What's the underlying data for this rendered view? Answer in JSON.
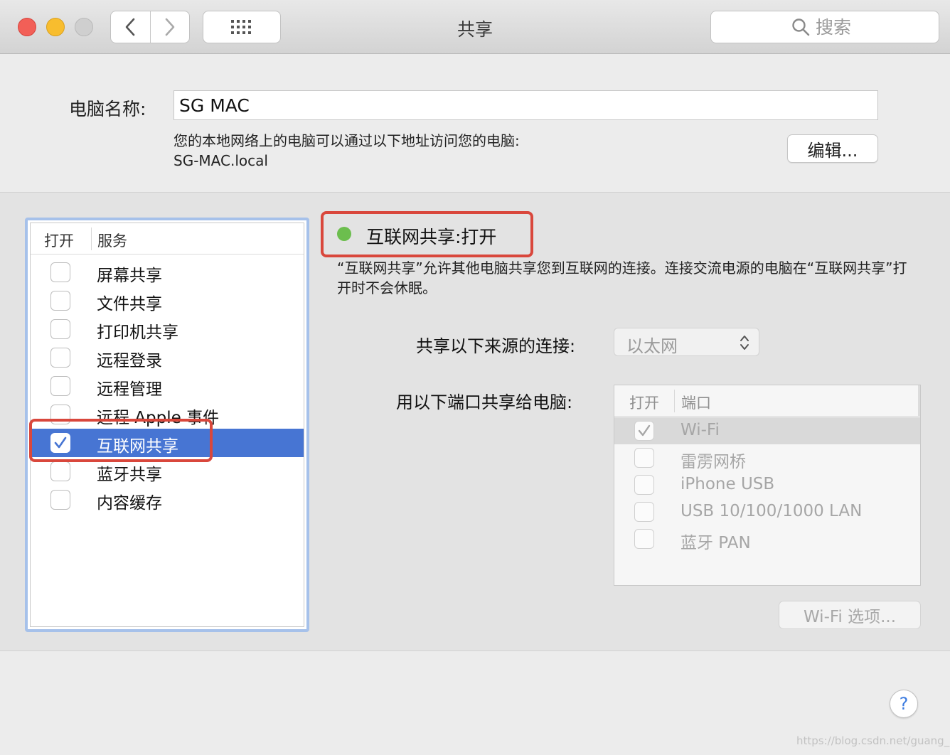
{
  "window": {
    "title": "共享",
    "search_placeholder": "搜索",
    "icons": {
      "back": "chevron-left-icon",
      "forward": "chevron-right-icon",
      "grid": "grid-icon",
      "search": "search-icon"
    }
  },
  "computer_name": {
    "label": "电脑名称:",
    "value": "SG MAC",
    "address_note": "您的本地网络上的电脑可以通过以下地址访问您的电脑:",
    "local_address": "SG-MAC.local",
    "edit_label": "编辑..."
  },
  "services": {
    "header_on": "打开",
    "header_service": "服务",
    "items": [
      {
        "label": "屏幕共享",
        "checked": false,
        "selected": false
      },
      {
        "label": "文件共享",
        "checked": false,
        "selected": false
      },
      {
        "label": "打印机共享",
        "checked": false,
        "selected": false
      },
      {
        "label": "远程登录",
        "checked": false,
        "selected": false
      },
      {
        "label": "远程管理",
        "checked": false,
        "selected": false
      },
      {
        "label": "远程 Apple 事件",
        "checked": false,
        "selected": false
      },
      {
        "label": "互联网共享",
        "checked": true,
        "selected": true
      },
      {
        "label": "蓝牙共享",
        "checked": false,
        "selected": false
      },
      {
        "label": "内容缓存",
        "checked": false,
        "selected": false
      }
    ]
  },
  "detail": {
    "status_title": "互联网共享:打开",
    "status_color": "#6cbe4e",
    "description": "“互联网共享”允许其他电脑共享您到互联网的连接。连接交流电源的电脑在“互联网共享”打开时不会休眠。",
    "share_from_label": "共享以下来源的连接:",
    "share_from_value": "以太网",
    "share_to_label": "用以下端口共享给电脑:",
    "ports_header_on": "打开",
    "ports_header_port": "端口",
    "ports": [
      {
        "label": "Wi-Fi",
        "checked": true,
        "highlighted": true
      },
      {
        "label": "雷雳网桥",
        "checked": false,
        "highlighted": false
      },
      {
        "label": "iPhone USB",
        "checked": false,
        "highlighted": false
      },
      {
        "label": "USB 10/100/1000 LAN",
        "checked": false,
        "highlighted": false
      },
      {
        "label": "蓝牙 PAN",
        "checked": false,
        "highlighted": false
      }
    ],
    "wifi_options_label": "Wi-Fi 选项..."
  },
  "help_label": "?",
  "watermark": "https://blog.csdn.net/guang_s",
  "colors": {
    "selection": "#4775d3",
    "highlight_box": "#d9473c",
    "focus_ring": "#a6c1ea"
  }
}
